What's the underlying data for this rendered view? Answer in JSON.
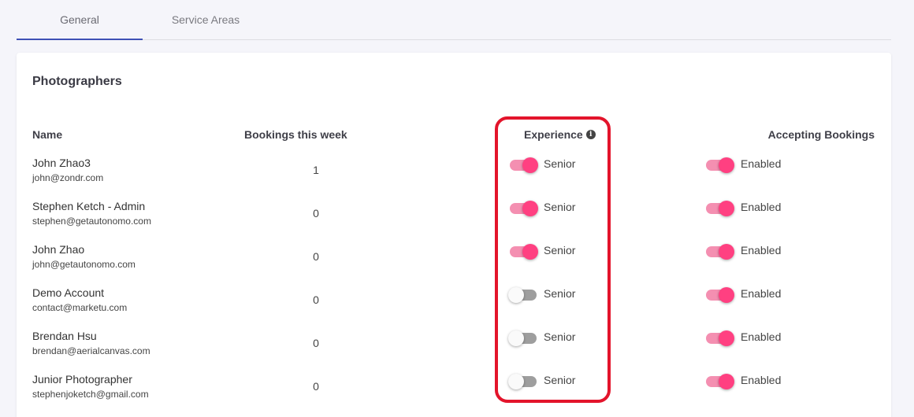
{
  "tabs": [
    {
      "label": "General",
      "active": true
    },
    {
      "label": "Service Areas",
      "active": false
    }
  ],
  "card": {
    "title": "Photographers",
    "columns": {
      "name": "Name",
      "bookings": "Bookings this week",
      "experience": "Experience",
      "accepting": "Accepting Bookings"
    }
  },
  "rows": [
    {
      "name": "John Zhao3",
      "email": "john@zondr.com",
      "bookings": "1",
      "experience": "Senior",
      "experience_on": true,
      "accepting": "Enabled",
      "accepting_on": true
    },
    {
      "name": "Stephen Ketch - Admin",
      "email": "stephen@getautonomo.com",
      "bookings": "0",
      "experience": "Senior",
      "experience_on": true,
      "accepting": "Enabled",
      "accepting_on": true
    },
    {
      "name": "John Zhao",
      "email": "john@getautonomo.com",
      "bookings": "0",
      "experience": "Senior",
      "experience_on": true,
      "accepting": "Enabled",
      "accepting_on": true
    },
    {
      "name": "Demo Account",
      "email": "contact@marketu.com",
      "bookings": "0",
      "experience": "Senior",
      "experience_on": false,
      "accepting": "Enabled",
      "accepting_on": true
    },
    {
      "name": "Brendan Hsu",
      "email": "brendan@aerialcanvas.com",
      "bookings": "0",
      "experience": "Senior",
      "experience_on": false,
      "accepting": "Enabled",
      "accepting_on": true
    },
    {
      "name": "Junior Photographer",
      "email": "stephenjoketch@gmail.com",
      "bookings": "0",
      "experience": "Senior",
      "experience_on": false,
      "accepting": "Enabled",
      "accepting_on": true
    }
  ],
  "icons": {
    "experience_info": "info-circle-icon"
  },
  "colors": {
    "tab_indicator": "#3f51b5",
    "toggle_on_knob": "#ff4081",
    "toggle_on_track": "#f48fb1",
    "toggle_off_track": "#9e9e9e",
    "highlight": "#e3142b"
  }
}
